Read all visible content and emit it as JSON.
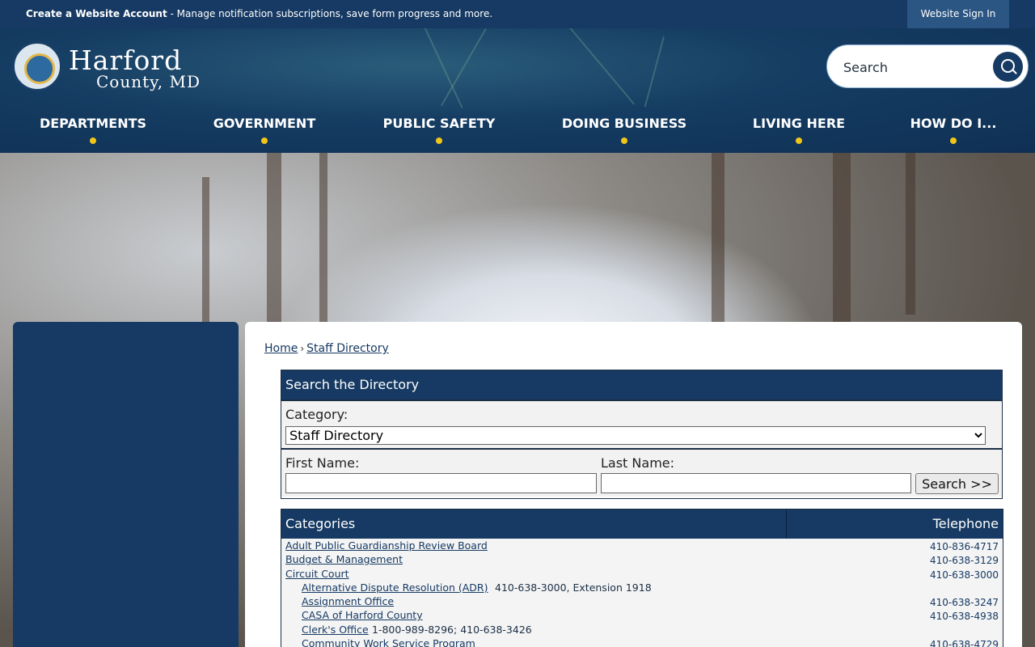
{
  "topbar": {
    "create_account": "Create a Website Account",
    "message": " - Manage notification subscriptions, save form progress and more.",
    "signin": "Website Sign In"
  },
  "brand": {
    "line1": "Harford",
    "line2": "County, MD"
  },
  "search": {
    "placeholder": "Search"
  },
  "nav": [
    {
      "label": "DEPARTMENTS"
    },
    {
      "label": "GOVERNMENT"
    },
    {
      "label": "PUBLIC SAFETY"
    },
    {
      "label": "DOING BUSINESS"
    },
    {
      "label": "LIVING HERE"
    },
    {
      "label": "HOW DO I..."
    }
  ],
  "breadcrumb": {
    "home": "Home",
    "separator": "›",
    "current": "Staff Directory"
  },
  "search_box": {
    "title": "Search the Directory",
    "category_label": "Category:",
    "category_selected": "Staff Directory",
    "first_name_label": "First Name:",
    "last_name_label": "Last Name:",
    "submit": "Search >>"
  },
  "table": {
    "col1": "Categories",
    "col2": "Telephone",
    "rows": [
      {
        "name": "Adult Public Guardianship Review Board",
        "extra": "",
        "tel": "410-836-4717",
        "indent": 0
      },
      {
        "name": "Budget & Management",
        "extra": "",
        "tel": "410-638-3129",
        "indent": 0
      },
      {
        "name": "Circuit Court",
        "extra": "",
        "tel": "410-638-3000",
        "indent": 0
      },
      {
        "name": "Alternative Dispute Resolution (ADR)",
        "extra": " 410-638-3000, Extension 1918",
        "tel": "",
        "indent": 1
      },
      {
        "name": "Assignment Office",
        "extra": "",
        "tel": "410-638-3247",
        "indent": 1
      },
      {
        "name": "CASA of Harford County",
        "extra": "",
        "tel": "410-638-4938",
        "indent": 1
      },
      {
        "name": "Clerk's Office",
        "extra": " 1-800-989-8296; 410-638-3426",
        "tel": "",
        "indent": 1
      },
      {
        "name": "Community Work Service Program",
        "extra": "",
        "tel": "410-638-4729",
        "indent": 1
      }
    ]
  }
}
